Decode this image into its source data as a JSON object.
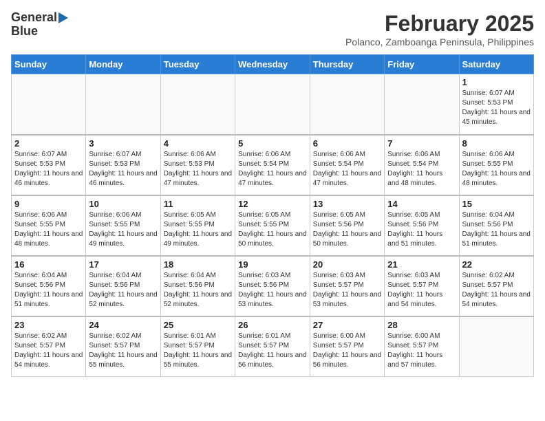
{
  "header": {
    "logo_line1": "General",
    "logo_line2": "Blue",
    "month": "February 2025",
    "location": "Polanco, Zamboanga Peninsula, Philippines"
  },
  "weekdays": [
    "Sunday",
    "Monday",
    "Tuesday",
    "Wednesday",
    "Thursday",
    "Friday",
    "Saturday"
  ],
  "weeks": [
    [
      {
        "day": "",
        "info": ""
      },
      {
        "day": "",
        "info": ""
      },
      {
        "day": "",
        "info": ""
      },
      {
        "day": "",
        "info": ""
      },
      {
        "day": "",
        "info": ""
      },
      {
        "day": "",
        "info": ""
      },
      {
        "day": "1",
        "info": "Sunrise: 6:07 AM\nSunset: 5:53 PM\nDaylight: 11 hours\nand 45 minutes."
      }
    ],
    [
      {
        "day": "2",
        "info": "Sunrise: 6:07 AM\nSunset: 5:53 PM\nDaylight: 11 hours\nand 46 minutes."
      },
      {
        "day": "3",
        "info": "Sunrise: 6:07 AM\nSunset: 5:53 PM\nDaylight: 11 hours\nand 46 minutes."
      },
      {
        "day": "4",
        "info": "Sunrise: 6:06 AM\nSunset: 5:53 PM\nDaylight: 11 hours\nand 47 minutes."
      },
      {
        "day": "5",
        "info": "Sunrise: 6:06 AM\nSunset: 5:54 PM\nDaylight: 11 hours\nand 47 minutes."
      },
      {
        "day": "6",
        "info": "Sunrise: 6:06 AM\nSunset: 5:54 PM\nDaylight: 11 hours\nand 47 minutes."
      },
      {
        "day": "7",
        "info": "Sunrise: 6:06 AM\nSunset: 5:54 PM\nDaylight: 11 hours\nand 48 minutes."
      },
      {
        "day": "8",
        "info": "Sunrise: 6:06 AM\nSunset: 5:55 PM\nDaylight: 11 hours\nand 48 minutes."
      }
    ],
    [
      {
        "day": "9",
        "info": "Sunrise: 6:06 AM\nSunset: 5:55 PM\nDaylight: 11 hours\nand 48 minutes."
      },
      {
        "day": "10",
        "info": "Sunrise: 6:06 AM\nSunset: 5:55 PM\nDaylight: 11 hours\nand 49 minutes."
      },
      {
        "day": "11",
        "info": "Sunrise: 6:05 AM\nSunset: 5:55 PM\nDaylight: 11 hours\nand 49 minutes."
      },
      {
        "day": "12",
        "info": "Sunrise: 6:05 AM\nSunset: 5:55 PM\nDaylight: 11 hours\nand 50 minutes."
      },
      {
        "day": "13",
        "info": "Sunrise: 6:05 AM\nSunset: 5:56 PM\nDaylight: 11 hours\nand 50 minutes."
      },
      {
        "day": "14",
        "info": "Sunrise: 6:05 AM\nSunset: 5:56 PM\nDaylight: 11 hours\nand 51 minutes."
      },
      {
        "day": "15",
        "info": "Sunrise: 6:04 AM\nSunset: 5:56 PM\nDaylight: 11 hours\nand 51 minutes."
      }
    ],
    [
      {
        "day": "16",
        "info": "Sunrise: 6:04 AM\nSunset: 5:56 PM\nDaylight: 11 hours\nand 51 minutes."
      },
      {
        "day": "17",
        "info": "Sunrise: 6:04 AM\nSunset: 5:56 PM\nDaylight: 11 hours\nand 52 minutes."
      },
      {
        "day": "18",
        "info": "Sunrise: 6:04 AM\nSunset: 5:56 PM\nDaylight: 11 hours\nand 52 minutes."
      },
      {
        "day": "19",
        "info": "Sunrise: 6:03 AM\nSunset: 5:56 PM\nDaylight: 11 hours\nand 53 minutes."
      },
      {
        "day": "20",
        "info": "Sunrise: 6:03 AM\nSunset: 5:57 PM\nDaylight: 11 hours\nand 53 minutes."
      },
      {
        "day": "21",
        "info": "Sunrise: 6:03 AM\nSunset: 5:57 PM\nDaylight: 11 hours\nand 54 minutes."
      },
      {
        "day": "22",
        "info": "Sunrise: 6:02 AM\nSunset: 5:57 PM\nDaylight: 11 hours\nand 54 minutes."
      }
    ],
    [
      {
        "day": "23",
        "info": "Sunrise: 6:02 AM\nSunset: 5:57 PM\nDaylight: 11 hours\nand 54 minutes."
      },
      {
        "day": "24",
        "info": "Sunrise: 6:02 AM\nSunset: 5:57 PM\nDaylight: 11 hours\nand 55 minutes."
      },
      {
        "day": "25",
        "info": "Sunrise: 6:01 AM\nSunset: 5:57 PM\nDaylight: 11 hours\nand 55 minutes."
      },
      {
        "day": "26",
        "info": "Sunrise: 6:01 AM\nSunset: 5:57 PM\nDaylight: 11 hours\nand 56 minutes."
      },
      {
        "day": "27",
        "info": "Sunrise: 6:00 AM\nSunset: 5:57 PM\nDaylight: 11 hours\nand 56 minutes."
      },
      {
        "day": "28",
        "info": "Sunrise: 6:00 AM\nSunset: 5:57 PM\nDaylight: 11 hours\nand 57 minutes."
      },
      {
        "day": "",
        "info": ""
      }
    ]
  ]
}
